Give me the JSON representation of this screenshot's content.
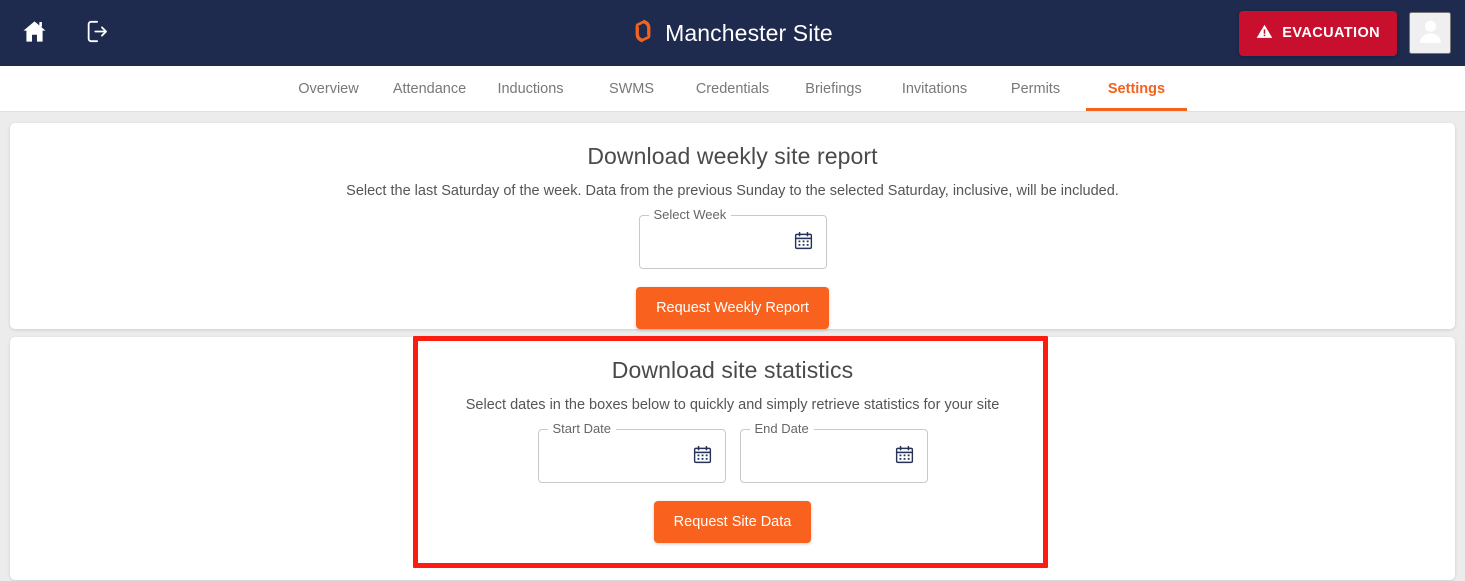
{
  "header": {
    "home_icon": "home-icon",
    "logout_icon": "logout-icon",
    "logo_icon": "brand-logo-icon",
    "site_title": "Manchester Site",
    "evacuation_label": "EVACUATION",
    "evacuation_icon": "warning-triangle-icon",
    "account_icon": "person-icon",
    "background_color": "#1e2a4e",
    "evacuation_color": "#c8102e"
  },
  "nav": {
    "accent_color": "#f4621f",
    "tabs": [
      {
        "label": "Overview",
        "active": false
      },
      {
        "label": "Attendance",
        "active": false
      },
      {
        "label": "Inductions",
        "active": false
      },
      {
        "label": "SWMS",
        "active": false
      },
      {
        "label": "Credentials",
        "active": false
      },
      {
        "label": "Briefings",
        "active": false
      },
      {
        "label": "Invitations",
        "active": false
      },
      {
        "label": "Permits",
        "active": false
      },
      {
        "label": "Settings",
        "active": true
      }
    ]
  },
  "weekly_report_card": {
    "title": "Download weekly site report",
    "subtitle": "Select the last Saturday of the week. Data from the previous Sunday to the selected Saturday, inclusive, will be included.",
    "week_field": {
      "label": "Select Week",
      "value": "",
      "placeholder": "",
      "calendar_icon": "calendar-icon"
    },
    "button_label": "Request Weekly Report",
    "button_color": "#f9621e"
  },
  "site_statistics_card": {
    "title": "Download site statistics",
    "subtitle": "Select dates in the boxes below to quickly and simply retrieve statistics for your site",
    "start_field": {
      "label": "Start Date",
      "value": "",
      "placeholder": "",
      "calendar_icon": "calendar-icon"
    },
    "end_field": {
      "label": "End Date",
      "value": "",
      "placeholder": "",
      "calendar_icon": "calendar-icon"
    },
    "button_label": "Request Site Data",
    "button_color": "#f9621e",
    "highlight_color": "#fc1c10"
  }
}
